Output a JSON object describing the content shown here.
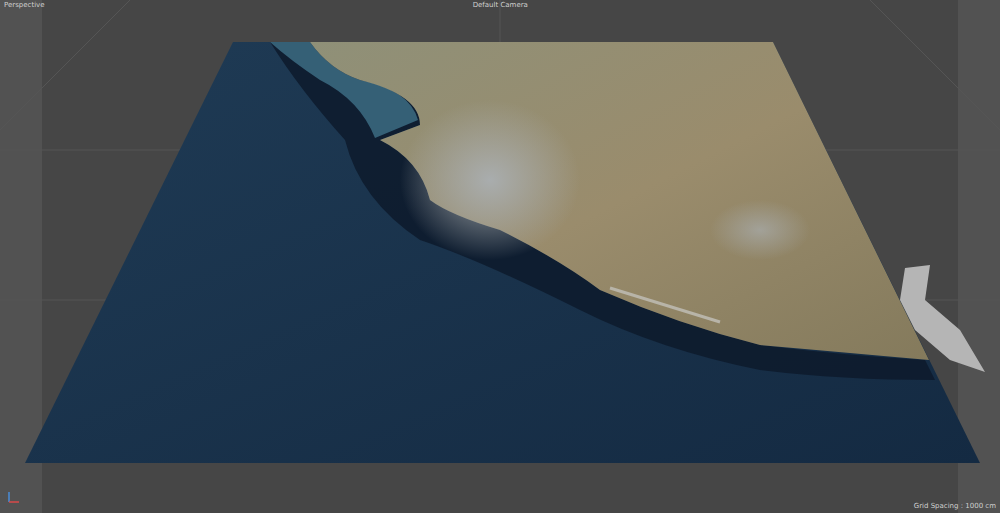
{
  "viewport": {
    "label": "Perspective",
    "camera": "Default Camera",
    "grid_spacing": "Grid Spacing : 1000 cm"
  }
}
